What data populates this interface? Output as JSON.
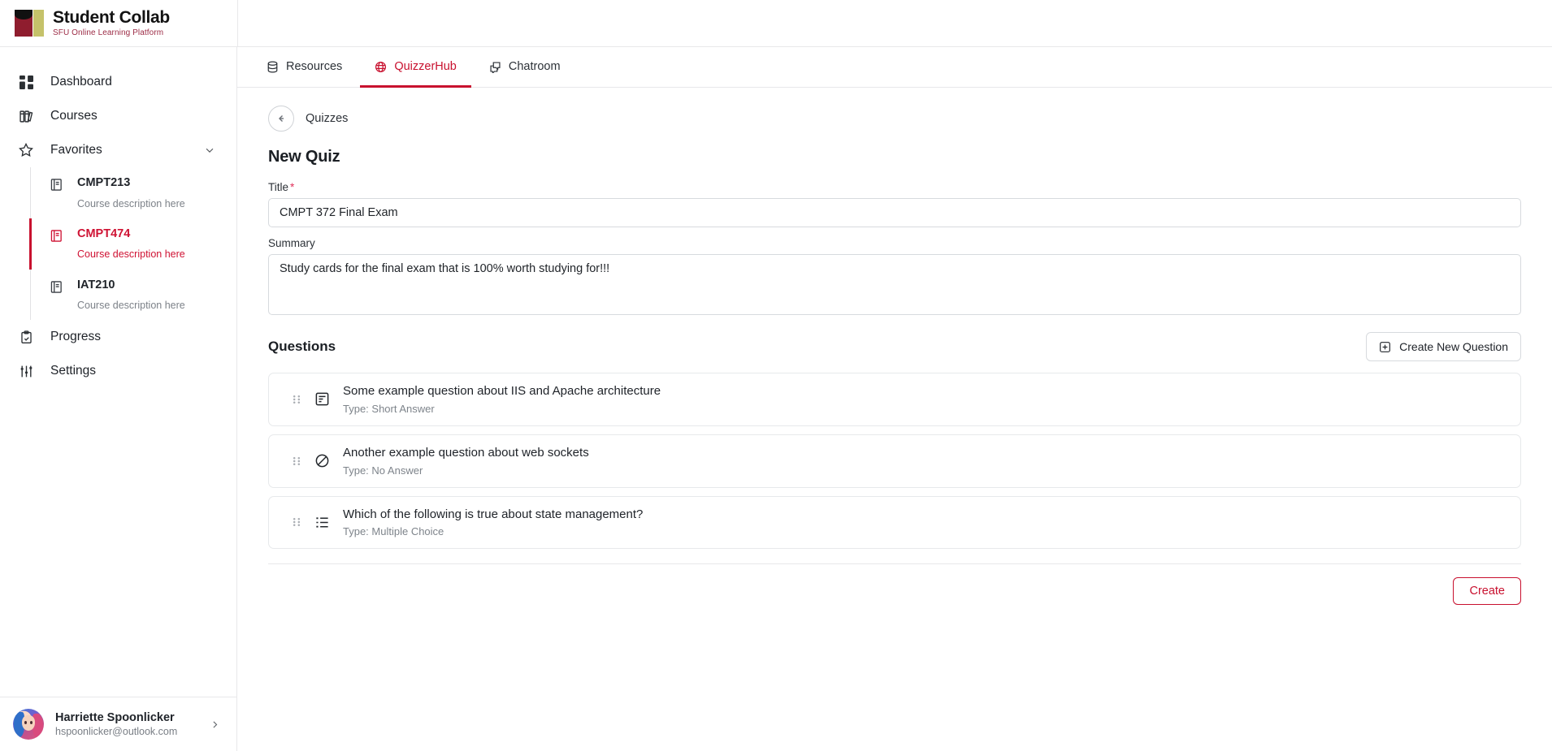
{
  "brand": {
    "title": "Student Collab",
    "subtitle": "SFU Online Learning Platform",
    "colors": {
      "red": "#8f1d2e",
      "olive": "#c5c26a",
      "accent": "#c8102e"
    }
  },
  "sidebar": {
    "nav": [
      {
        "label": "Dashboard",
        "icon": "dashboard-icon"
      },
      {
        "label": "Courses",
        "icon": "books-icon"
      },
      {
        "label": "Favorites",
        "icon": "star-icon",
        "expanded": true,
        "chevron": "chevron-down-icon"
      }
    ],
    "favorites": [
      {
        "name": "CMPT213",
        "description": "Course description here",
        "active": false
      },
      {
        "name": "CMPT474",
        "description": "Course description here",
        "active": true
      },
      {
        "name": "IAT210",
        "description": "Course description here",
        "active": false
      }
    ],
    "nav_bottom": [
      {
        "label": "Progress",
        "icon": "clipboard-icon"
      },
      {
        "label": "Settings",
        "icon": "sliders-icon"
      }
    ],
    "user": {
      "name": "Harriette Spoonlicker",
      "email": "hspoonlicker@outlook.com",
      "chevron": "chevron-right-icon",
      "avatar": "user-avatar"
    }
  },
  "tabs": [
    {
      "label": "Resources",
      "icon": "database-icon",
      "active": false
    },
    {
      "label": "QuizzerHub",
      "icon": "globe-icon",
      "active": true
    },
    {
      "label": "Chatroom",
      "icon": "chat-icon",
      "active": false
    }
  ],
  "breadcrumb": {
    "back_icon": "arrow-left-circle-icon",
    "label": "Quizzes"
  },
  "page": {
    "title": "New Quiz",
    "fields": {
      "title": {
        "label": "Title",
        "required_marker": "*",
        "value": "CMPT 372 Final Exam",
        "placeholder": "Quiz title"
      },
      "summary": {
        "label": "Summary",
        "value": "Study cards for the final exam that is 100% worth studying for!!!",
        "placeholder": "Quiz summary"
      }
    },
    "questions_section": {
      "title": "Questions",
      "create_button": {
        "label": "Create New Question",
        "icon": "plus-square-icon"
      },
      "items": [
        {
          "text": "Some example question about IIS and Apache architecture",
          "type": "Type: Short Answer",
          "icon": "short-answer-icon",
          "drag_handle": "drag-handle-icon"
        },
        {
          "text": "Another example question about web sockets",
          "type": "Type: No Answer",
          "icon": "no-answer-icon",
          "drag_handle": "drag-handle-icon"
        },
        {
          "text": "Which of the following is true about state management?",
          "type": "Type: Multiple Choice",
          "icon": "list-icon",
          "drag_handle": "drag-handle-icon"
        }
      ]
    },
    "submit_button": {
      "label": "Create"
    }
  }
}
